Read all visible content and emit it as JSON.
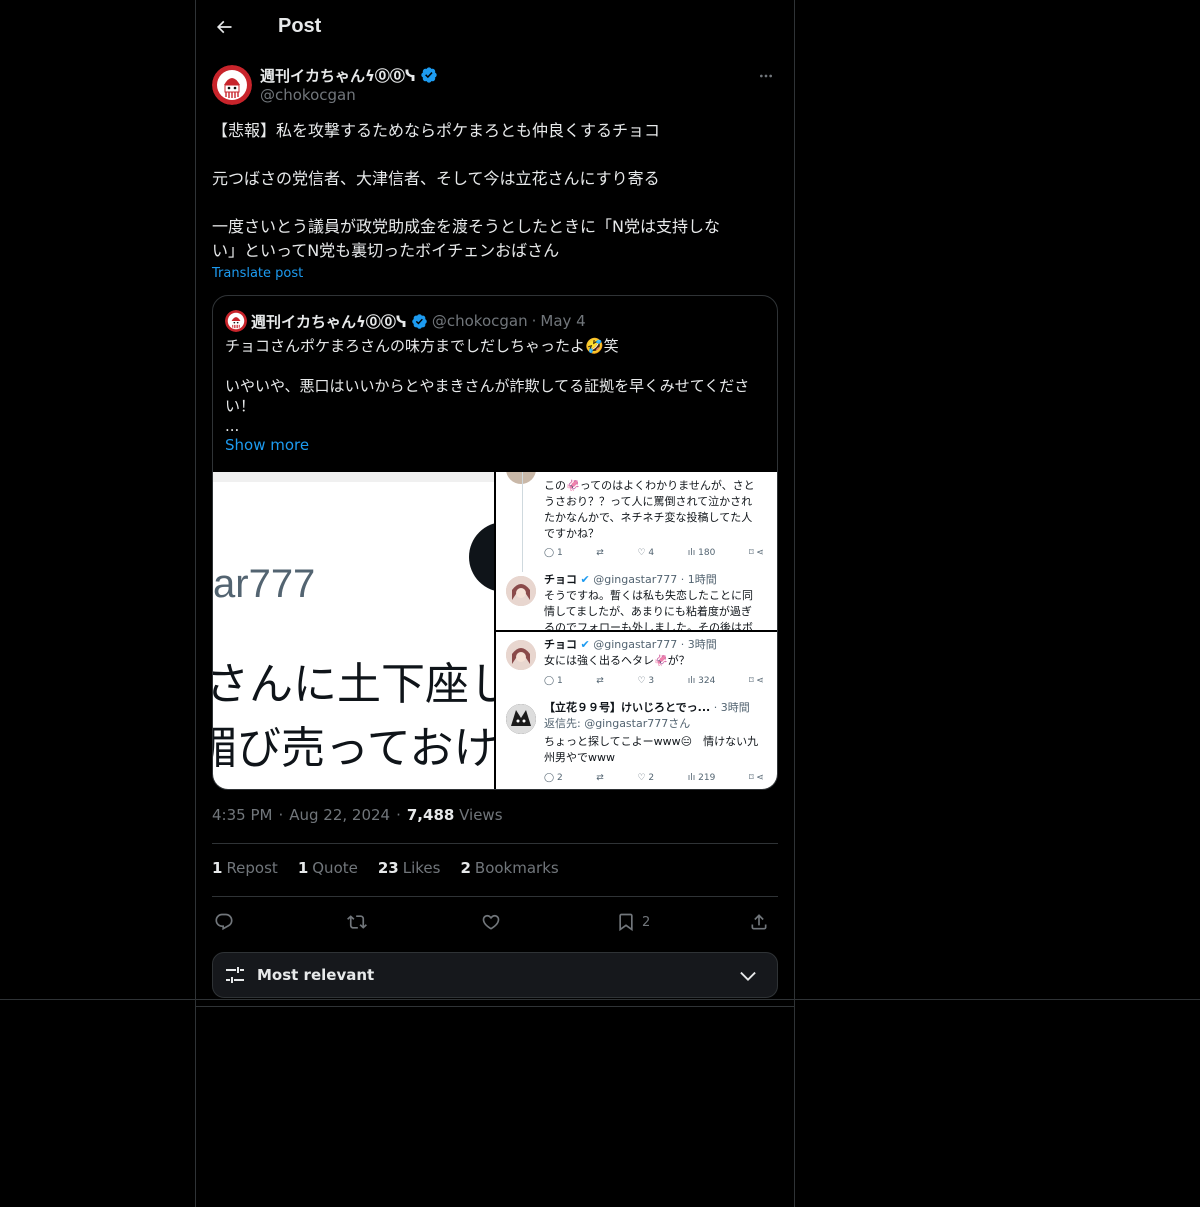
{
  "header": {
    "title": "Post"
  },
  "post": {
    "author_name": "週刊イカちゃんϟᴏᴏₐ",
    "author_name_display": "週刊イカちゃんϟ⓪⓪ᓭ",
    "handle": "@chokocgan",
    "paragraphs": [
      "【悲報】私を攻撃するためならポケまろとも仲良くするチョコ",
      "元つばさの党信者、大津信者、そして今は立花さんにすり寄る",
      "一度さいとう議員が政党助成金を渡そうとしたときに「N党は支持しな",
      "い」といってN党も裏切ったボイチェンおばさん"
    ],
    "translate_label": "Translate post",
    "timestamp": "4:35 PM · Aug 22, 2024 ·",
    "time": "4:35 PM",
    "date": "Aug 22, 2024",
    "views_count": "7,488",
    "views_label": "Views"
  },
  "quote": {
    "author_name": "週刊イカちゃんϟ⓪⓪ᓭ",
    "handle": "@chokocgan",
    "sep": "·",
    "date": "May 4",
    "line1": "チョコさんポケまろさんの味方までしだしちゃったよ🤣笑",
    "line2": "いやいや、悪口はいいからとやまきさんが詐欺してる証拠を早くみせてくださ",
    "line3": "い！",
    "ellipsis": "...",
    "show_more": "Show more"
  },
  "media": {
    "left_text_1": "ar777",
    "left_text_2": "さんに土下座し",
    "left_text_3": "媚び売っておけ",
    "rt_lines": [
      "この🦑ってのはよくわかりませんが、さと",
      "うさおり？？って人に罵倒されて泣かされ",
      "たかなんかで、ネチネチ変な投稿してた人",
      "ですかね？"
    ],
    "rt_actions": [
      "1",
      "",
      "4",
      "180"
    ],
    "rt2_name": "チョコ",
    "rt2_meta": "@gingastar777 · 1時間",
    "rt2_lines": [
      "そうですね。暫くは私も失恋したことに同",
      "情してましたが、あまりにも粘着度が過ぎ",
      "るのでフォローも外しました。その後はボ"
    ],
    "rb_name": "チョコ",
    "rb_meta": "@gingastar777 · 3時間",
    "rb_line": "女には強く出るヘタレ🦑が？",
    "rb_actions": [
      "1",
      "",
      "3",
      "324"
    ],
    "rb2_name": "【立花９９号】けいじろとでっ...",
    "rb2_meta": "· 3時間",
    "rb2_reply": "返信先: @gingastar777さん",
    "rb2_line1": "ちょっと探してこよーwww😑　情けない九",
    "rb2_line2": "州男やでwww",
    "rb2_actions": [
      "2",
      "",
      "2",
      "219"
    ]
  },
  "stats": [
    {
      "count": "1",
      "label": "Repost"
    },
    {
      "count": "1",
      "label": "Quote"
    },
    {
      "count": "23",
      "label": "Likes"
    },
    {
      "count": "2",
      "label": "Bookmarks"
    }
  ],
  "actions": {
    "bookmark_count": "2"
  },
  "sort": {
    "label": "Most relevant"
  },
  "colors": {
    "accent": "#1d9bf0",
    "muted": "#71767b",
    "text": "#e7e9ea",
    "bg": "#000000",
    "border": "#2f3336"
  }
}
